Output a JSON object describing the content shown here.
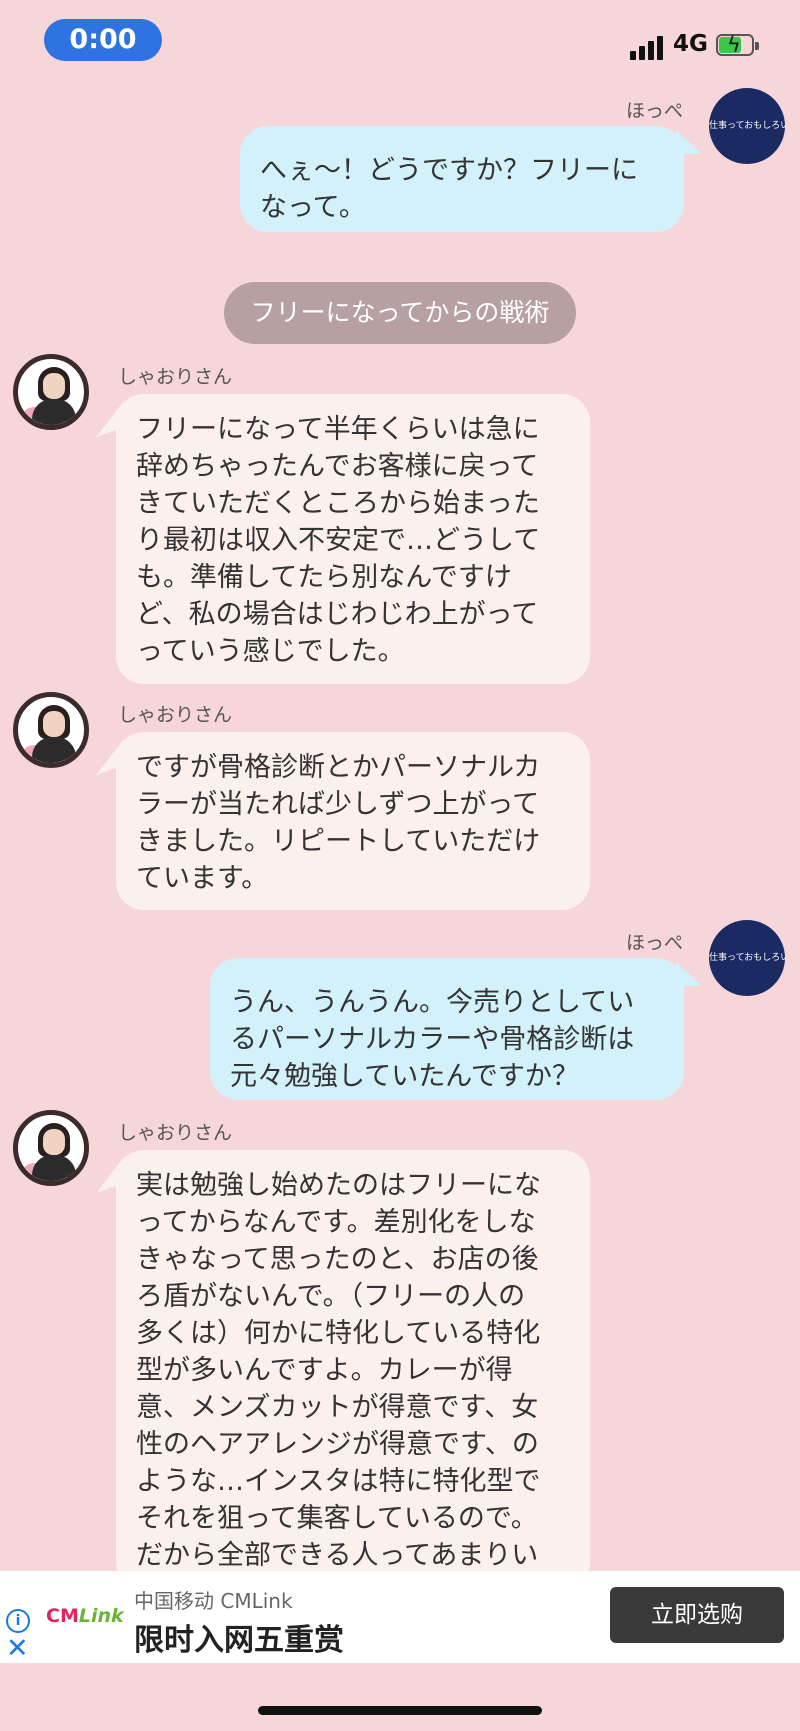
{
  "status_bar": {
    "time": "0:00",
    "network": "4G"
  },
  "section_label": "フリーになってからの戦術",
  "messages": [
    {
      "sender": "ほっぺ",
      "side": "right",
      "avatar_text": "仕事っておもしろいや",
      "text": "へぇ〜！どうですか？フリーに\nなって。"
    },
    {
      "sender": "しゃおりさん",
      "side": "left",
      "text": "フリーになって半年くらいは急に\n辞めちゃったんでお客様に戻って\nきていただくところから始まった\nり最初は収入不安定で…どうして\nも。準備してたら別なんですけ\nど、私の場合はじわじわ上がって\nっていう感じでした。"
    },
    {
      "sender": "しゃおりさん",
      "side": "left",
      "text": "ですが骨格診断とかパーソナルカ\nラーが当たれば少しずつ上がって\nきました。リピートしていただけ\nています。"
    },
    {
      "sender": "ほっぺ",
      "side": "right",
      "avatar_text": "仕事っておもしろいや",
      "text": "うん、うんうん。今売りとしてい\nるパーソナルカラーや骨格診断は\n元々勉強していたんですか？"
    },
    {
      "sender": "しゃおりさん",
      "side": "left",
      "text": "実は勉強し始めたのはフリーにな\nってからなんです。差別化をしな\nきゃなって思ったのと、お店の後\nろ盾がないんで。（フリーの人の\n多くは）何かに特化している特化\n型が多いんですよ。カレーが得\n意、メンズカットが得意です、女\n性のヘアアレンジが得意です、の\nような…インスタは特に特化型で\nそれを狙って集客しているので。\nだから全部できる人ってあまりい"
    }
  ],
  "ad": {
    "brand_left": "CM",
    "brand_right": "Link",
    "advertiser": "中国移动 CMLink",
    "headline": "限时入网五重赏",
    "cta": "立即选购"
  }
}
